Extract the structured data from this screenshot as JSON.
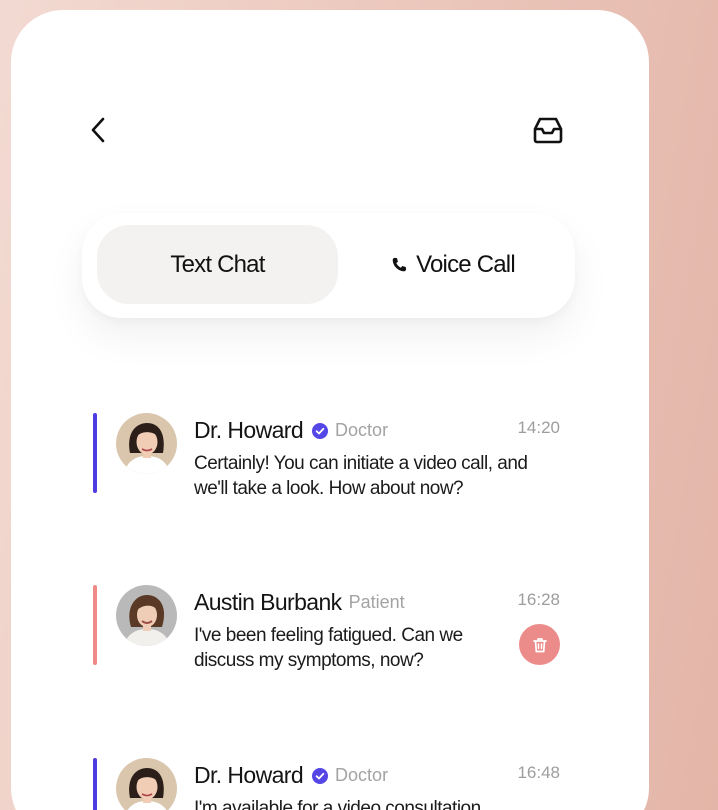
{
  "header": {
    "back_icon": "chevron-left-icon",
    "inbox_icon": "inbox-icon"
  },
  "tabs": [
    {
      "label": "Text Chat",
      "active": true
    },
    {
      "label": "Voice Call",
      "active": false,
      "icon": "phone-icon"
    }
  ],
  "messages": [
    {
      "name": "Dr. Howard",
      "verified": true,
      "role": "Doctor",
      "time": "14:20",
      "text": "Certainly! You can initiate a video call, and we'll take a look. How about now?",
      "accent": "#4f3ce0"
    },
    {
      "name": "Austin Burbank",
      "verified": false,
      "role": "Patient",
      "time": "16:28",
      "text": "I've been feeling fatigued. Can we discuss my symptoms, now?",
      "accent": "#ef8a86",
      "action_icon": "trash-icon"
    },
    {
      "name": "Dr. Howard",
      "verified": true,
      "role": "Doctor",
      "time": "16:48",
      "text": "I'm available for a video consultation.",
      "accent": "#4f3ce0"
    }
  ],
  "colors": {
    "verified_badge": "#5546e6",
    "trash_button": "#ec8c8a"
  }
}
